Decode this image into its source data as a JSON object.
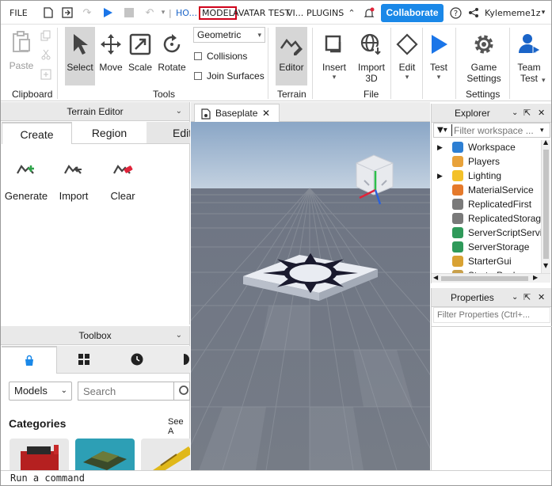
{
  "menubar": {
    "file": "FILE",
    "tabs": [
      "HO...",
      "MODEL",
      "AVATAR TEST",
      "VI...",
      "PLUGINS"
    ],
    "collaborate": "Collaborate",
    "username": "Kylememe1z"
  },
  "ribbon": {
    "clipboard": {
      "paste": "Paste",
      "label": "Clipboard"
    },
    "tools": {
      "select": "Select",
      "move": "Move",
      "scale": "Scale",
      "rotate": "Rotate",
      "label": "Tools"
    },
    "snapping": {
      "mode": "Geometric",
      "collisions": "Collisions",
      "join_surfaces": "Join Surfaces"
    },
    "terrain": {
      "editor": "Editor",
      "label": "Terrain"
    },
    "file": {
      "insert": "Insert",
      "import_3d_line1": "Import",
      "import_3d_line2": "3D",
      "label": "File"
    },
    "edit": {
      "edit": "Edit"
    },
    "test": {
      "test": "Test"
    },
    "settings": {
      "game_settings_line1": "Game",
      "game_settings_line2": "Settings",
      "label": "Settings"
    },
    "team_test": {
      "line1": "Team",
      "line2": "Test"
    }
  },
  "terrain_editor": {
    "title": "Terrain Editor",
    "tabs": [
      "Create",
      "Region",
      "Edit"
    ],
    "tools": [
      "Generate",
      "Import",
      "Clear"
    ]
  },
  "toolbox": {
    "title": "Toolbox",
    "category_select": "Models",
    "search_placeholder": "Search",
    "categories_heading": "Categories",
    "see_all": "See A"
  },
  "viewport": {
    "tab_label": "Baseplate"
  },
  "explorer": {
    "title": "Explorer",
    "filter_placeholder": "Filter workspace ...",
    "items": [
      "Workspace",
      "Players",
      "Lighting",
      "MaterialService",
      "ReplicatedFirst",
      "ReplicatedStorage",
      "ServerScriptService",
      "ServerStorage",
      "StarterGui",
      "StarterPack"
    ],
    "colors": [
      "#2d7fd3",
      "#e8a23a",
      "#f3c12a",
      "#e57a2b",
      "#7a7a7a",
      "#7a7a7a",
      "#2f9a5a",
      "#2f9a5a",
      "#d9a233",
      "#c8a04a"
    ]
  },
  "properties": {
    "title": "Properties",
    "filter_placeholder": "Filter Properties (Ctrl+..."
  },
  "command_bar": {
    "placeholder": "Run a command"
  },
  "colors": {
    "accent": "#1a88e8",
    "highlight_box": "#d0021b",
    "test_play": "#1a75e8"
  }
}
